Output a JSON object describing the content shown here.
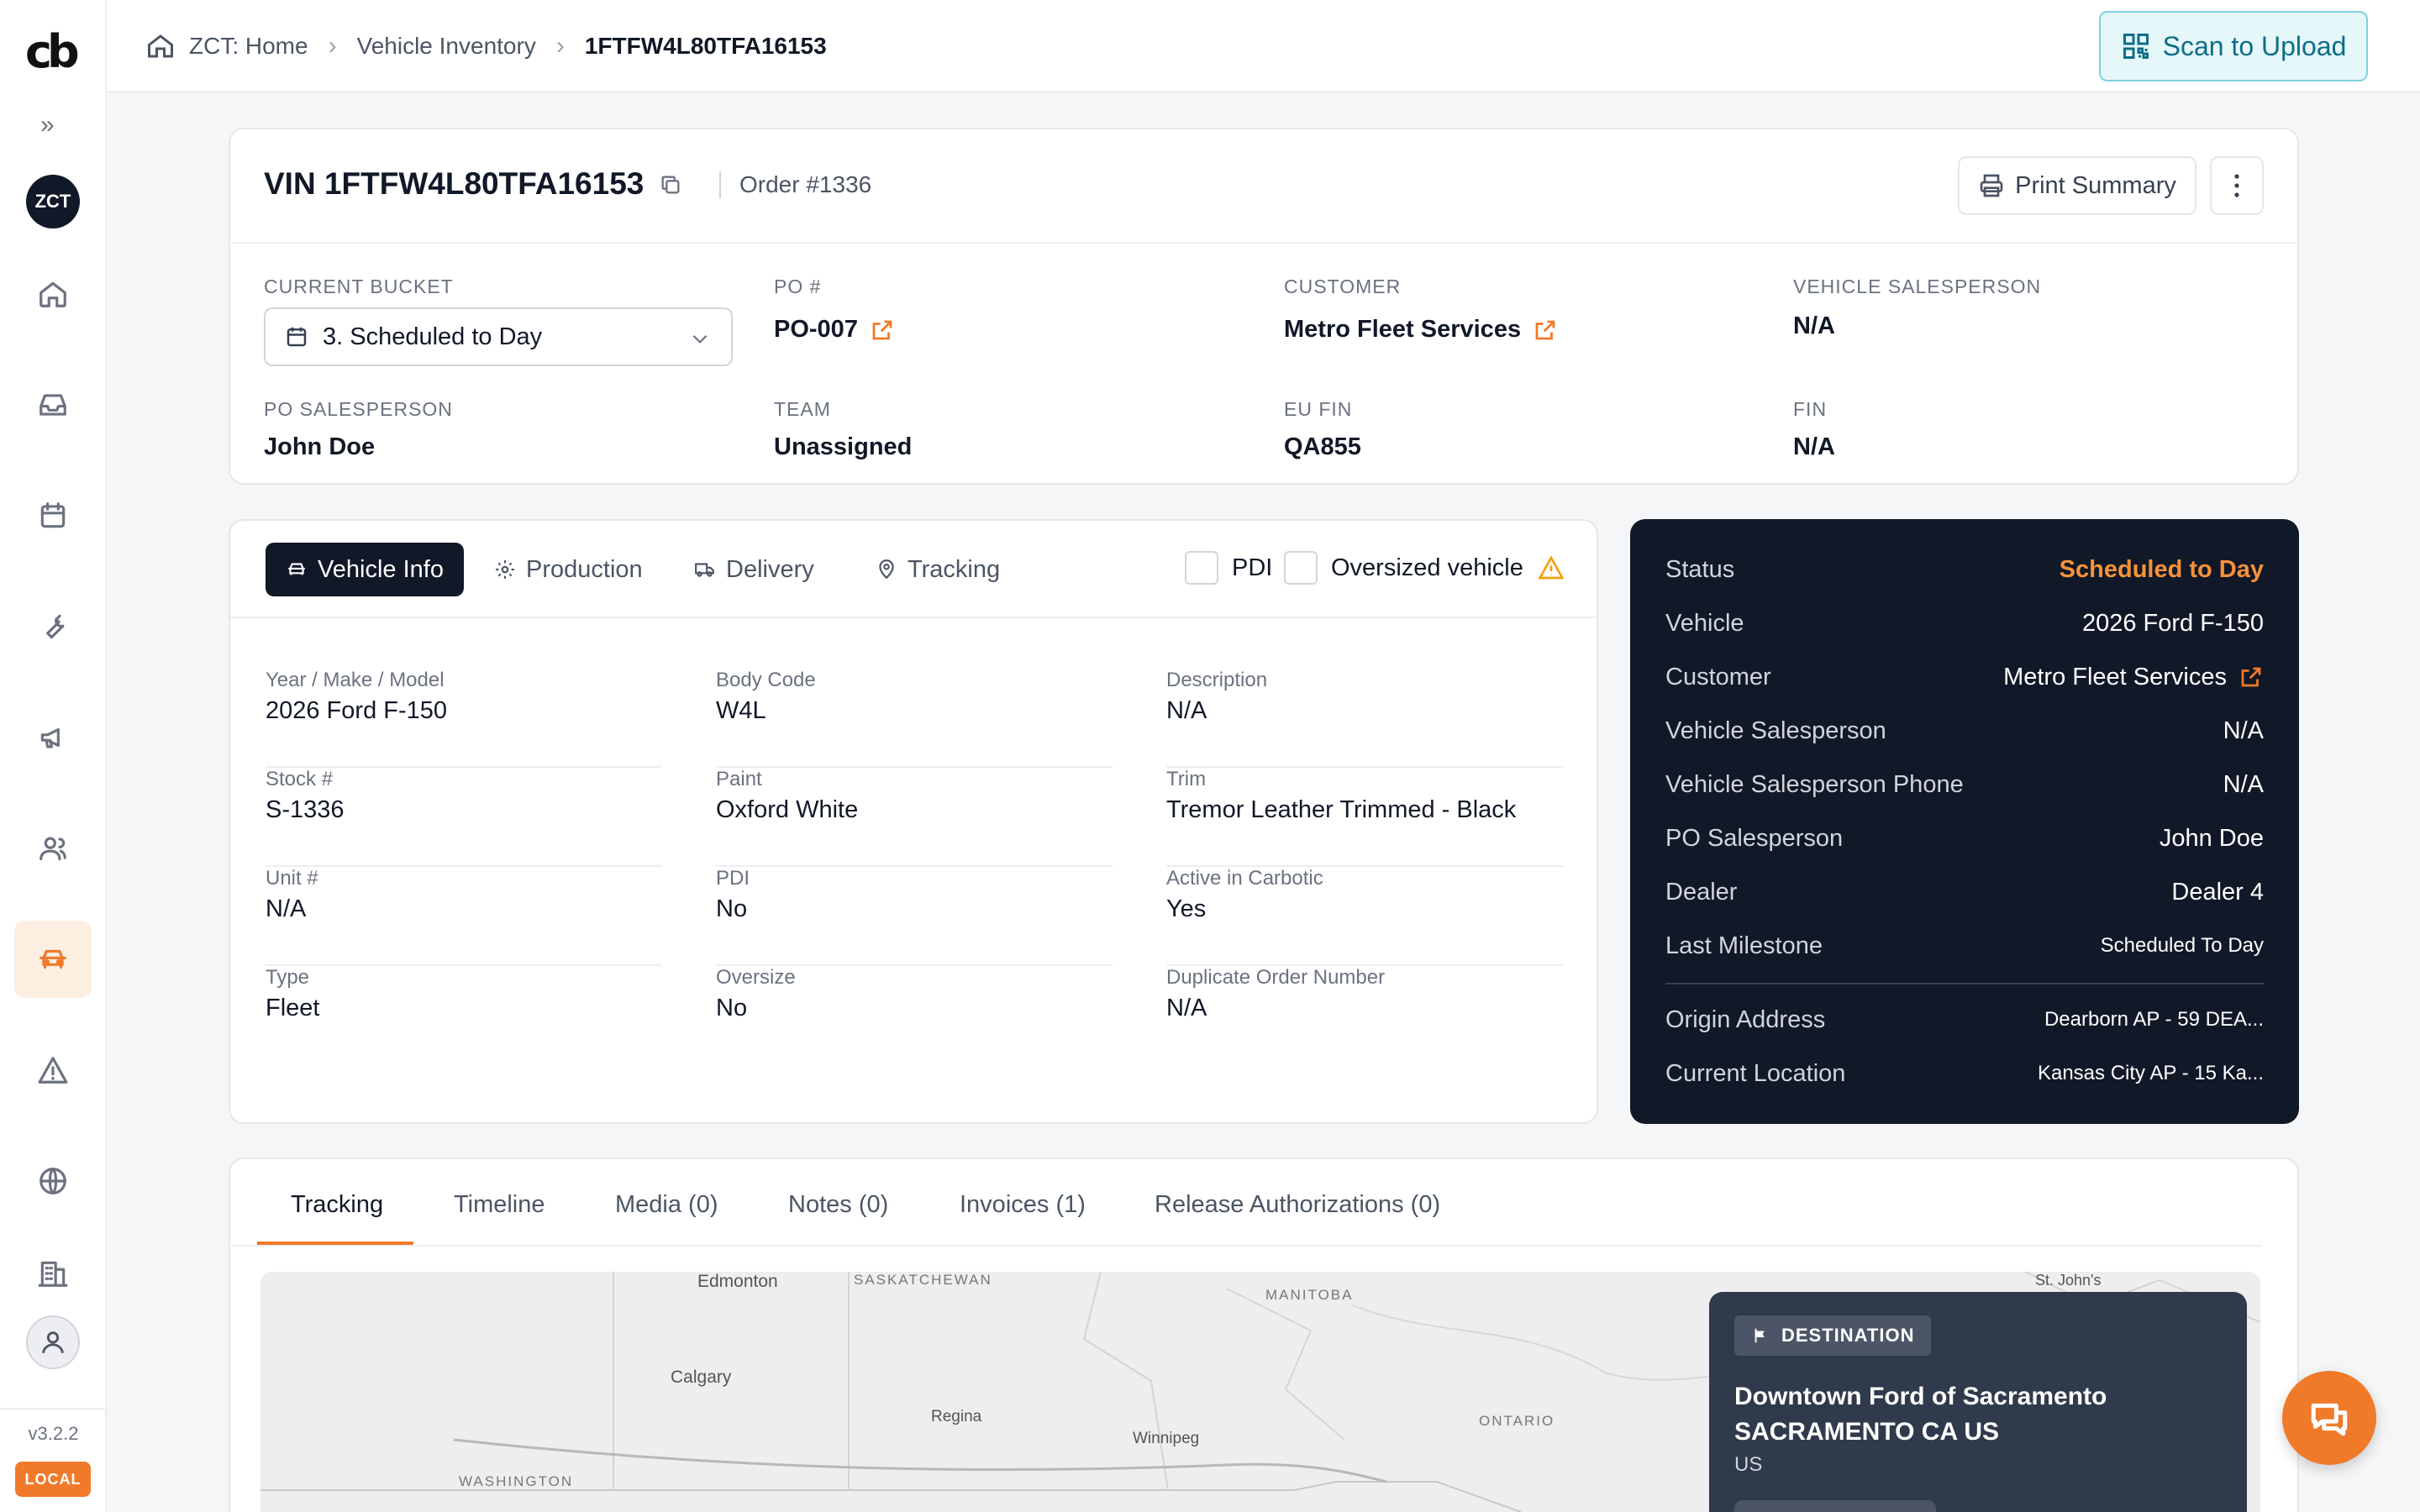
{
  "app": {
    "logo_text": "cb",
    "workspace": "ZCT",
    "version": "v3.2.2",
    "env_badge": "LOCAL"
  },
  "sidebar": {
    "items": [
      {
        "icon": "home-icon"
      },
      {
        "icon": "inbox-icon"
      },
      {
        "icon": "calendar-icon"
      },
      {
        "icon": "wrench-icon"
      },
      {
        "icon": "megaphone-icon"
      },
      {
        "icon": "users-icon"
      },
      {
        "icon": "car-icon",
        "active": true
      },
      {
        "icon": "warning-icon"
      },
      {
        "icon": "globe-icon"
      },
      {
        "icon": "building-icon"
      }
    ]
  },
  "breadcrumb": {
    "home": "ZCT: Home",
    "section": "Vehicle Inventory",
    "current": "1FTFW4L80TFA16153"
  },
  "scan_button": "Scan to Upload",
  "header": {
    "vin": "VIN 1FTFW4L80TFA16153",
    "order": "Order #1336",
    "print_label": "Print Summary"
  },
  "fields": {
    "bucket_label": "CURRENT BUCKET",
    "bucket_value": "3. Scheduled to Day",
    "po_label": "PO #",
    "po_value": "PO-007",
    "customer_label": "CUSTOMER",
    "customer_value": "Metro Fleet Services",
    "vsales_label": "VEHICLE SALESPERSON",
    "vsales_value": "N/A",
    "posales_label": "PO SALESPERSON",
    "posales_value": "John Doe",
    "team_label": "TEAM",
    "team_value": "Unassigned",
    "eufin_label": "EU FIN",
    "eufin_value": "QA855",
    "fin_label": "FIN",
    "fin_value": "N/A"
  },
  "info_tabs": [
    "Vehicle Info",
    "Production",
    "Delivery",
    "Tracking"
  ],
  "checkboxes": {
    "pdi": "PDI",
    "oversized": "Oversized vehicle"
  },
  "vehicle_info": [
    {
      "label": "Year / Make / Model",
      "value": "2026 Ford F-150"
    },
    {
      "label": "Body Code",
      "value": "W4L"
    },
    {
      "label": "Description",
      "value": "N/A"
    },
    {
      "label": "Stock #",
      "value": "S-1336"
    },
    {
      "label": "Paint",
      "value": "Oxford White"
    },
    {
      "label": "Trim",
      "value": "Tremor Leather Trimmed - Black"
    },
    {
      "label": "Unit #",
      "value": "N/A"
    },
    {
      "label": "PDI",
      "value": "No"
    },
    {
      "label": "Active in Carbotic",
      "value": "Yes"
    },
    {
      "label": "Type",
      "value": "Fleet"
    },
    {
      "label": "Oversize",
      "value": "No"
    },
    {
      "label": "Duplicate Order Number",
      "value": "N/A"
    }
  ],
  "status_panel": [
    {
      "label": "Status",
      "value": "Scheduled to Day"
    },
    {
      "label": "Vehicle",
      "value": "2026 Ford F-150"
    },
    {
      "label": "Customer",
      "value": "Metro Fleet Services"
    },
    {
      "label": "Vehicle Salesperson",
      "value": "N/A"
    },
    {
      "label": "Vehicle Salesperson Phone",
      "value": "N/A"
    },
    {
      "label": "PO Salesperson",
      "value": "John Doe"
    },
    {
      "label": "Dealer",
      "value": "Dealer 4"
    },
    {
      "label": "Last Milestone",
      "value": "Scheduled To Day"
    },
    {
      "label": "Origin Address",
      "value": "Dearborn AP - 59 DEA..."
    },
    {
      "label": "Current Location",
      "value": "Kansas City AP - 15 Ka..."
    }
  ],
  "bottom_tabs": [
    "Tracking",
    "Timeline",
    "Media (0)",
    "Notes (0)",
    "Invoices (1)",
    "Release Authorizations (0)"
  ],
  "map": {
    "labels": [
      "Edmonton",
      "SASKATCHEWAN",
      "MANITOBA",
      "St. John's",
      "Calgary",
      "Regina",
      "Winnipeg",
      "ONTARIO",
      "WASHINGTON"
    ]
  },
  "destination": {
    "badge": "DESTINATION",
    "name_line1": "Downtown Ford of Sacramento",
    "name_line2": "SACRAMENTO CA US",
    "country": "US"
  },
  "colors": {
    "accent": "#f07a2a",
    "dark_panel": "#111827",
    "scan_teal": "#0e6e87"
  }
}
